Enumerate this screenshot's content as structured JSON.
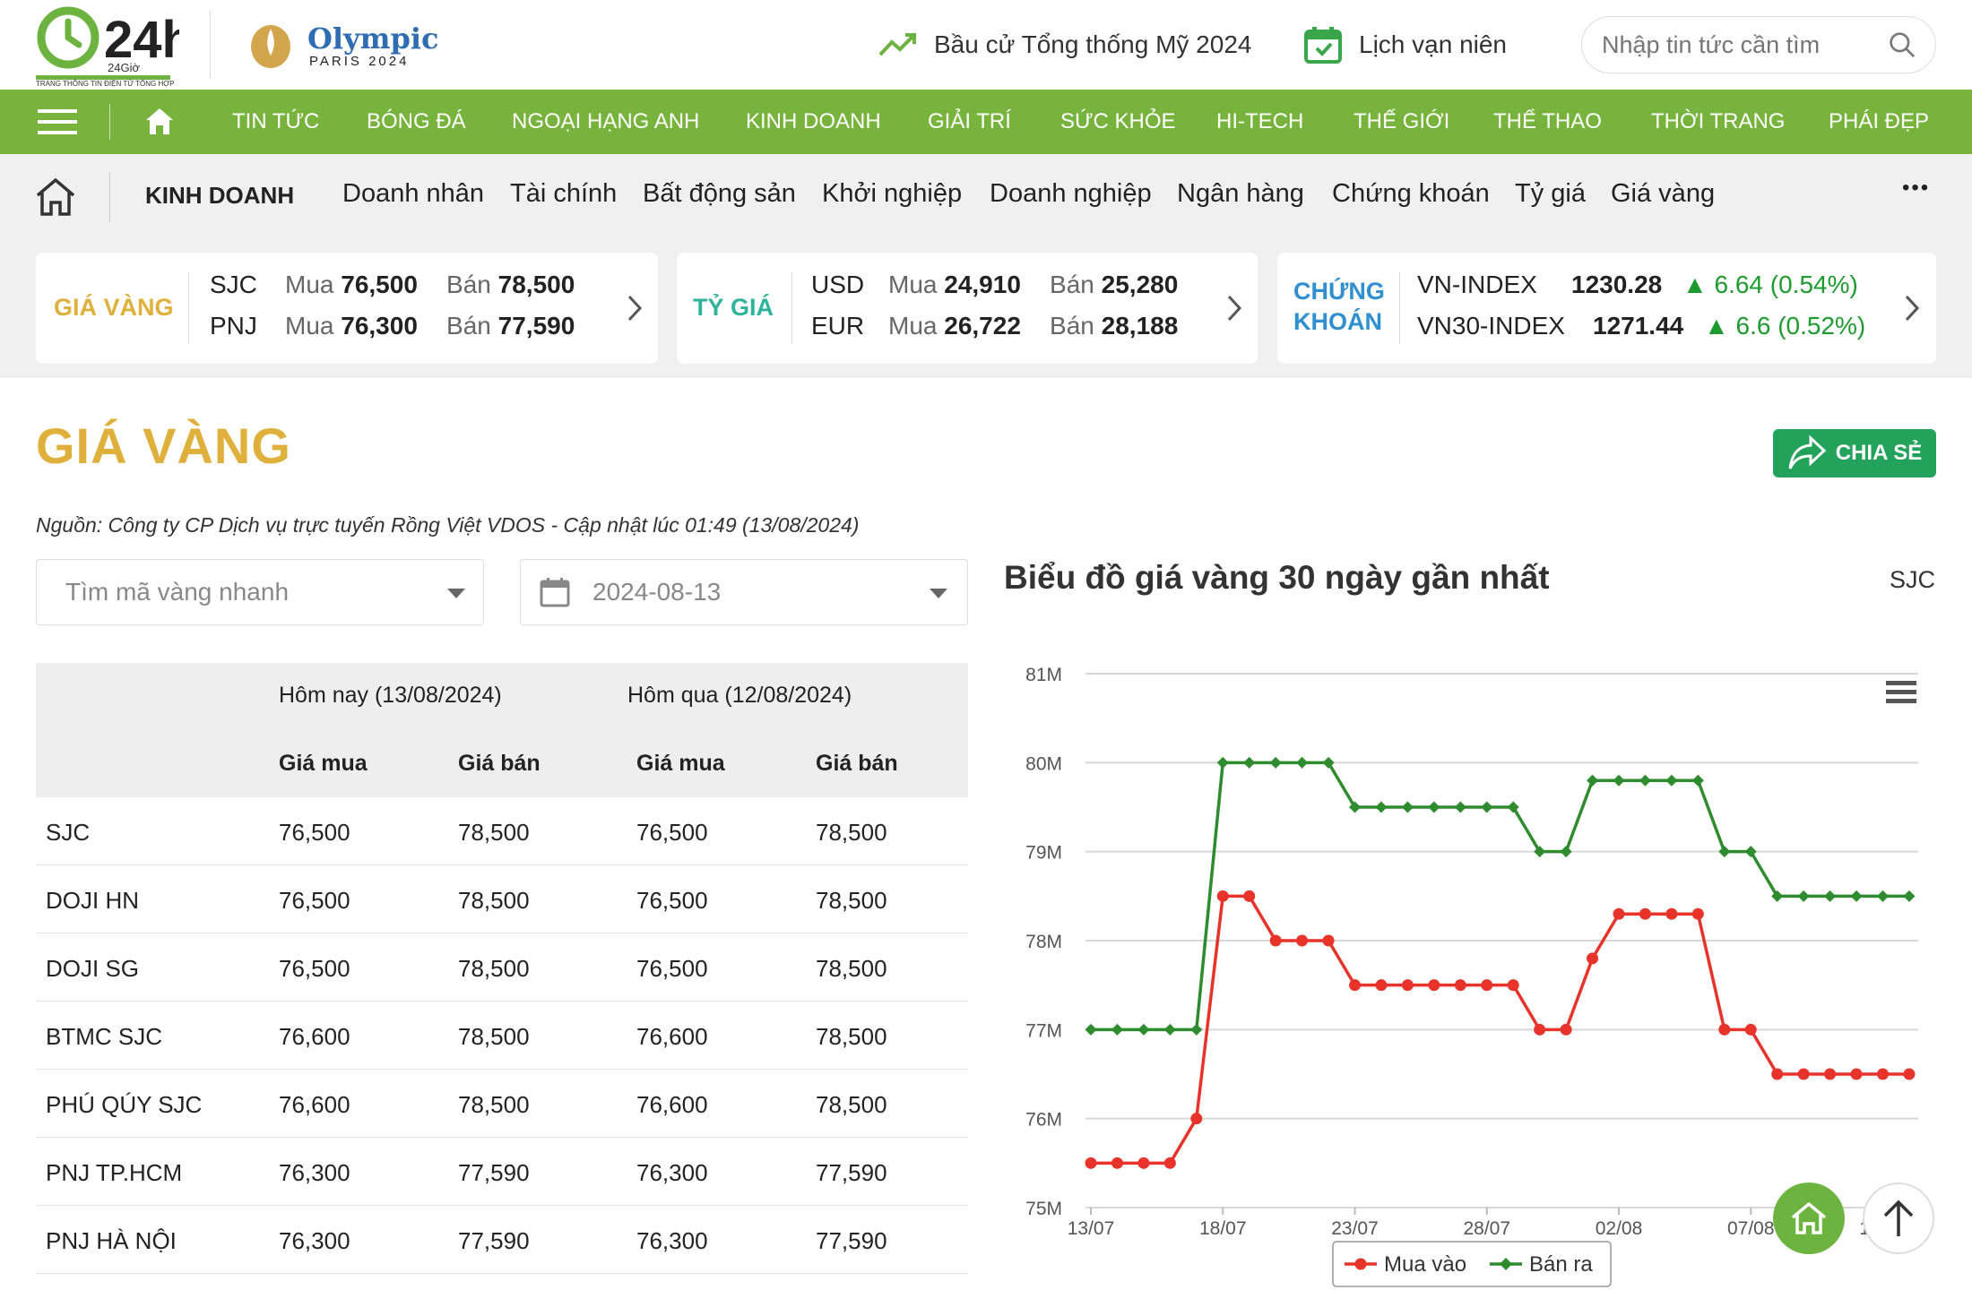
{
  "header": {
    "logo_text": "24h",
    "logo_sub": "24Giờ",
    "logo_tagline": "TRANG THÔNG TIN ĐIỆN TỬ TỔNG HỢP",
    "olympic_title": "Olympic",
    "olympic_sub": "PARIS 2024",
    "link1": "Bầu cử Tổng thống Mỹ 2024",
    "link2": "Lịch vạn niên",
    "search_placeholder": "Nhập tin tức cần tìm"
  },
  "nav": {
    "items": [
      "TIN TỨC",
      "BÓNG ĐÁ",
      "NGOẠI HẠNG ANH",
      "KINH DOANH",
      "GIẢI TRÍ",
      "SỨC KHỎE",
      "HI-TECH",
      "THẾ GIỚI",
      "THỂ THAO",
      "THỜI TRANG",
      "PHÁI ĐẸP"
    ]
  },
  "subnav": {
    "section": "KINH DOANH",
    "items": [
      "Doanh nhân",
      "Tài chính",
      "Bất động sản",
      "Khởi nghiệp",
      "Doanh nghiệp",
      "Ngân hàng",
      "Chứng khoán",
      "Tỷ giá",
      "Giá vàng"
    ],
    "more": "•••"
  },
  "ticker": {
    "gold": {
      "label": "GIÁ VÀNG",
      "r1_name": "SJC",
      "r1_buy_lbl": "Mua",
      "r1_buy": "76,500",
      "r1_sell_lbl": "Bán",
      "r1_sell": "78,500",
      "r2_name": "PNJ",
      "r2_buy_lbl": "Mua",
      "r2_buy": "76,300",
      "r2_sell_lbl": "Bán",
      "r2_sell": "77,590"
    },
    "fx": {
      "label": "TỶ GIÁ",
      "r1_name": "USD",
      "r1_buy_lbl": "Mua",
      "r1_buy": "24,910",
      "r1_sell_lbl": "Bán",
      "r1_sell": "25,280",
      "r2_name": "EUR",
      "r2_buy_lbl": "Mua",
      "r2_buy": "26,722",
      "r2_sell_lbl": "Bán",
      "r2_sell": "28,188"
    },
    "stock": {
      "label1": "CHỨNG",
      "label2": "KHOÁN",
      "r1_name": "VN-INDEX",
      "r1_val": "1230.28",
      "r1_chg": "▲ 6.64 (0.54%)",
      "r2_name": "VN30-INDEX",
      "r2_val": "1271.44",
      "r2_chg": "▲ 6.6 (0.52%)"
    },
    "colors": {
      "gold": "#e0b03c",
      "fx": "#2fb39b",
      "stock": "#2f8fd0",
      "up": "#1e9b2e"
    }
  },
  "page": {
    "title": "GIÁ VÀNG",
    "share": "CHIA SẺ",
    "source": "Nguồn: Công ty CP Dịch vụ trực tuyến Rồng Việt VDOS - Cập nhật lúc 01:49 (13/08/2024)",
    "search_placeholder": "Tìm mã vàng nhanh",
    "date_value": "2024-08-13"
  },
  "table": {
    "today": "Hôm nay (13/08/2024)",
    "yesterday": "Hôm qua (12/08/2024)",
    "buy": "Giá mua",
    "sell": "Giá bán",
    "rows": [
      [
        "SJC",
        "76,500",
        "78,500",
        "76,500",
        "78,500"
      ],
      [
        "DOJI HN",
        "76,500",
        "78,500",
        "76,500",
        "78,500"
      ],
      [
        "DOJI SG",
        "76,500",
        "78,500",
        "76,500",
        "78,500"
      ],
      [
        "BTMC SJC",
        "76,600",
        "78,500",
        "76,600",
        "78,500"
      ],
      [
        "PHÚ QÚY SJC",
        "76,600",
        "78,500",
        "76,600",
        "78,500"
      ],
      [
        "PNJ TP.HCM",
        "76,300",
        "77,590",
        "76,300",
        "77,590"
      ],
      [
        "PNJ HÀ NỘI",
        "76,300",
        "77,590",
        "76,300",
        "77,590"
      ]
    ]
  },
  "chart_title": "Biểu đồ giá vàng 30 ngày gần nhất",
  "chart_selector": "SJC",
  "chart_data": {
    "type": "line",
    "x": [
      "13/07",
      "14/07",
      "15/07",
      "16/07",
      "17/07",
      "18/07",
      "19/07",
      "20/07",
      "21/07",
      "22/07",
      "23/07",
      "24/07",
      "25/07",
      "26/07",
      "27/07",
      "28/07",
      "29/07",
      "30/07",
      "31/07",
      "01/08",
      "02/08",
      "03/08",
      "04/08",
      "05/08",
      "06/08",
      "07/08",
      "08/08",
      "09/08",
      "10/08",
      "11/08",
      "12/08",
      "13/08"
    ],
    "x_ticks": [
      "13/07",
      "18/07",
      "23/07",
      "28/07",
      "02/08",
      "07/08",
      "12/08"
    ],
    "yticks": [
      "75M",
      "76M",
      "77M",
      "78M",
      "79M",
      "80M",
      "81M"
    ],
    "ylim": [
      75,
      81
    ],
    "series": [
      {
        "name": "Mua vào",
        "color": "#e8332a",
        "values": [
          75.5,
          75.5,
          75.5,
          75.5,
          76.0,
          78.5,
          78.5,
          78.0,
          78.0,
          78.0,
          77.5,
          77.5,
          77.5,
          77.5,
          77.5,
          77.5,
          77.5,
          77.0,
          77.0,
          77.8,
          78.3,
          78.3,
          78.3,
          78.3,
          77.0,
          77.0,
          76.5,
          76.5,
          76.5,
          76.5,
          76.5,
          76.5
        ]
      },
      {
        "name": "Bán ra",
        "color": "#2e8b2e",
        "values": [
          77.0,
          77.0,
          77.0,
          77.0,
          77.0,
          80.0,
          80.0,
          80.0,
          80.0,
          80.0,
          79.5,
          79.5,
          79.5,
          79.5,
          79.5,
          79.5,
          79.5,
          79.0,
          79.0,
          79.8,
          79.8,
          79.8,
          79.8,
          79.8,
          79.0,
          79.0,
          78.5,
          78.5,
          78.5,
          78.5,
          78.5,
          78.5
        ]
      }
    ],
    "grid": true,
    "legend": "bottom"
  }
}
